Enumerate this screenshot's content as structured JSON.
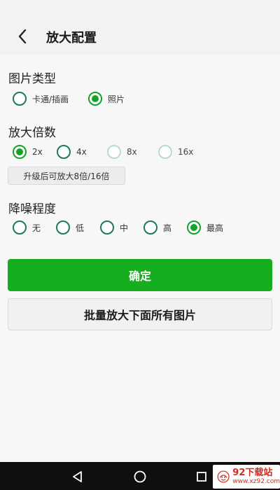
{
  "header": {
    "title": "放大配置",
    "back_icon": "chevron-left-icon"
  },
  "image_type": {
    "title": "图片类型",
    "options": [
      {
        "label": "卡通/插画",
        "checked": false
      },
      {
        "label": "照片",
        "checked": true
      }
    ]
  },
  "scale": {
    "title": "放大倍数",
    "options": [
      {
        "label": "2x",
        "checked": true,
        "enabled": true
      },
      {
        "label": "4x",
        "checked": false,
        "enabled": true
      },
      {
        "label": "8x",
        "checked": false,
        "enabled": false
      },
      {
        "label": "16x",
        "checked": false,
        "enabled": false
      }
    ],
    "upgrade_note": "升级后可放大8倍/16倍"
  },
  "denoise": {
    "title": "降噪程度",
    "options": [
      {
        "label": "无",
        "checked": false
      },
      {
        "label": "低",
        "checked": false
      },
      {
        "label": "中",
        "checked": false
      },
      {
        "label": "高",
        "checked": false
      },
      {
        "label": "最高",
        "checked": true
      }
    ]
  },
  "buttons": {
    "confirm": "确定",
    "batch": "批量放大下面所有图片"
  },
  "navbar": {
    "icons": [
      "back-triangle-icon",
      "home-circle-icon",
      "recents-square-icon"
    ]
  },
  "watermark": {
    "main": "92下载站",
    "sub": "www.xz92.com"
  },
  "colors": {
    "accent": "#16ad1e",
    "radio_ring": "#1e7a55",
    "radio_disabled": "#b7dcc8"
  }
}
